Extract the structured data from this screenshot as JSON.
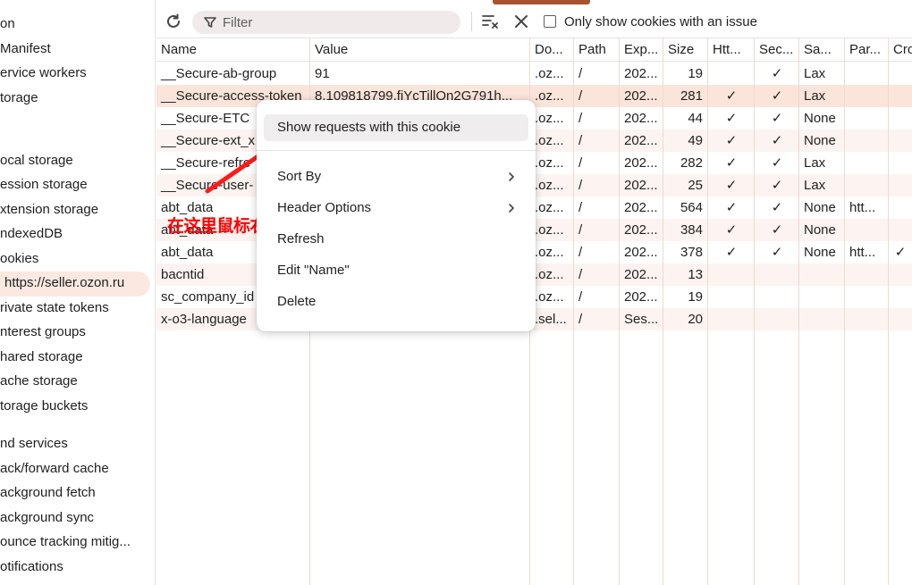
{
  "sidebar": {
    "items": [
      {
        "label": "on",
        "selected": false
      },
      {
        "label": "Manifest",
        "selected": false
      },
      {
        "label": "ervice workers",
        "selected": false
      },
      {
        "label": "torage",
        "selected": false
      },
      {
        "label": "ocal storage",
        "selected": false
      },
      {
        "label": "ession storage",
        "selected": false
      },
      {
        "label": "xtension storage",
        "selected": false
      },
      {
        "label": "ndexedDB",
        "selected": false
      },
      {
        "label": "ookies",
        "selected": false
      },
      {
        "label": "https://seller.ozon.ru",
        "selected": true
      },
      {
        "label": "rivate state tokens",
        "selected": false
      },
      {
        "label": "nterest groups",
        "selected": false
      },
      {
        "label": "hared storage",
        "selected": false
      },
      {
        "label": "ache storage",
        "selected": false
      },
      {
        "label": "torage buckets",
        "selected": false
      },
      {
        "label": "nd services",
        "selected": false
      },
      {
        "label": "ack/forward cache",
        "selected": false
      },
      {
        "label": "ackground fetch",
        "selected": false
      },
      {
        "label": "ackground sync",
        "selected": false
      },
      {
        "label": "ounce tracking mitig...",
        "selected": false
      },
      {
        "label": "otifications",
        "selected": false
      }
    ]
  },
  "toolbar": {
    "refresh_icon": "refresh-icon",
    "filter_placeholder": "Filter",
    "clear_filter_icon": "clear-filter-icon",
    "delete_icon": "close-icon",
    "issue_checkbox_checked": false,
    "issue_label": "Only show cookies with an issue"
  },
  "table": {
    "columns": [
      "Name",
      "Value",
      "Do...",
      "Path",
      "Exp...",
      "Size",
      "Htt...",
      "Sec...",
      "Sa...",
      "Par...",
      "Cro"
    ],
    "rows": [
      {
        "name": "__Secure-ab-group",
        "value": "91",
        "domain": ".oz...",
        "path": "/",
        "expires": "202...",
        "size": "19",
        "httponly": "",
        "secure": "✓",
        "samesite": "Lax",
        "partition": "",
        "cross": "",
        "selected": false
      },
      {
        "name": "__Secure-access-token",
        "value": "8.109818799.fiYcTillOn2G791h...",
        "domain": ".oz...",
        "path": "/",
        "expires": "202...",
        "size": "281",
        "httponly": "✓",
        "secure": "✓",
        "samesite": "Lax",
        "partition": "",
        "cross": "",
        "selected": true
      },
      {
        "name": "__Secure-ETC",
        "value": "",
        "domain": ".oz...",
        "path": "/",
        "expires": "202...",
        "size": "44",
        "httponly": "✓",
        "secure": "✓",
        "samesite": "None",
        "partition": "",
        "cross": "",
        "selected": false
      },
      {
        "name": "__Secure-ext_x",
        "value": "",
        "domain": ".oz...",
        "path": "/",
        "expires": "202...",
        "size": "49",
        "httponly": "✓",
        "secure": "✓",
        "samesite": "None",
        "partition": "",
        "cross": "",
        "selected": false
      },
      {
        "name": "__Secure-refre",
        "value": "",
        "domain": ".oz...",
        "path": "/",
        "expires": "202...",
        "size": "282",
        "httponly": "✓",
        "secure": "✓",
        "samesite": "Lax",
        "partition": "",
        "cross": "",
        "selected": false
      },
      {
        "name": "__Secure-user-",
        "value": "",
        "domain": ".oz...",
        "path": "/",
        "expires": "202...",
        "size": "25",
        "httponly": "✓",
        "secure": "✓",
        "samesite": "Lax",
        "partition": "",
        "cross": "",
        "selected": false
      },
      {
        "name": "abt_data",
        "value": "",
        "domain": ".oz...",
        "path": "/",
        "expires": "202...",
        "size": "564",
        "httponly": "✓",
        "secure": "✓",
        "samesite": "None",
        "partition": "htt...",
        "cross": "",
        "selected": false
      },
      {
        "name": "abt_data",
        "value": "",
        "domain": ".oz...",
        "path": "/",
        "expires": "202...",
        "size": "384",
        "httponly": "✓",
        "secure": "✓",
        "samesite": "None",
        "partition": "",
        "cross": "",
        "selected": false
      },
      {
        "name": "abt_data",
        "value": "",
        "domain": ".oz...",
        "path": "/",
        "expires": "202...",
        "size": "378",
        "httponly": "✓",
        "secure": "✓",
        "samesite": "None",
        "partition": "htt...",
        "cross": "✓",
        "selected": false
      },
      {
        "name": "bacntid",
        "value": "",
        "domain": ".oz...",
        "path": "/",
        "expires": "202...",
        "size": "13",
        "httponly": "",
        "secure": "",
        "samesite": "",
        "partition": "",
        "cross": "",
        "selected": false
      },
      {
        "name": "sc_company_id",
        "value": "",
        "domain": ".oz...",
        "path": "/",
        "expires": "202...",
        "size": "19",
        "httponly": "",
        "secure": "",
        "samesite": "",
        "partition": "",
        "cross": "",
        "selected": false
      },
      {
        "name": "x-o3-language",
        "value": "",
        "domain": ".sel...",
        "path": "/",
        "expires": "Ses...",
        "size": "20",
        "httponly": "",
        "secure": "",
        "samesite": "",
        "partition": "",
        "cross": "",
        "selected": false
      }
    ]
  },
  "context_menu": {
    "items": [
      {
        "label": "Show requests with this cookie",
        "highlighted": true,
        "submenu": false
      },
      {
        "label": "Sort By",
        "highlighted": false,
        "submenu": true
      },
      {
        "label": "Header Options",
        "highlighted": false,
        "submenu": true
      },
      {
        "label": "Refresh",
        "highlighted": false,
        "submenu": false
      },
      {
        "label": "Edit \"Name\"",
        "highlighted": false,
        "submenu": false
      },
      {
        "label": "Delete",
        "highlighted": false,
        "submenu": false
      }
    ]
  },
  "annotation": {
    "text": "在这里鼠标右键，点击这个选项",
    "color": "#ff0000"
  },
  "colors": {
    "accent": "#a8532d",
    "selected_row": "#fbe4da",
    "alt_row": "#fdf3f0",
    "selected_sidebar": "#fbe9e1"
  }
}
